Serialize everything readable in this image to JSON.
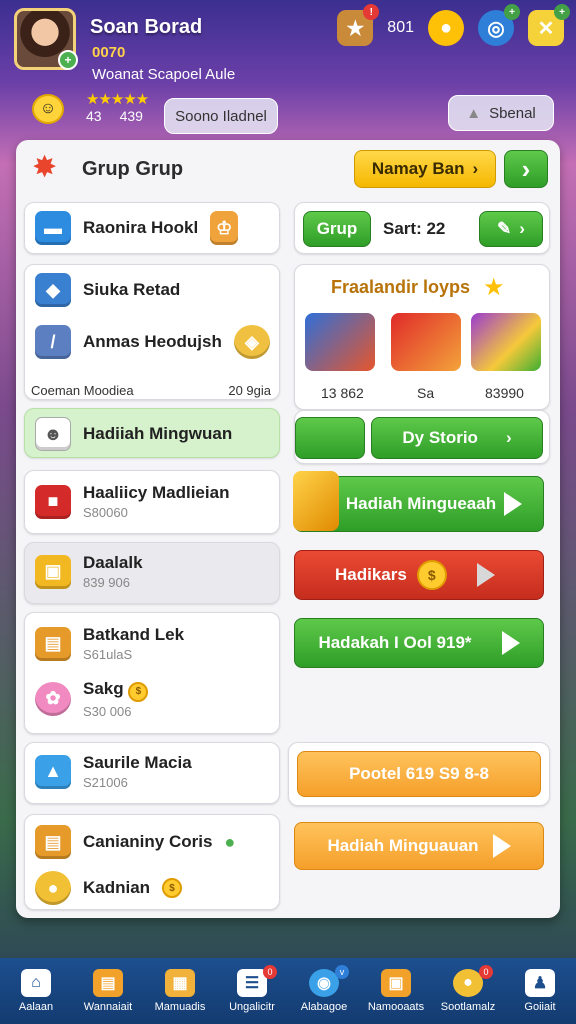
{
  "header": {
    "player_name": "Soan Borad",
    "player_sub": "0070",
    "player_desc": "Woanat Scapoel Aule",
    "coin_count": "801",
    "stat_left": "43",
    "stat_right": "439",
    "center_button": "Soono Iladnel",
    "right_button": "Sbenal"
  },
  "panel": {
    "title": "Grup Grup",
    "top_button": "Namay Ban",
    "left": {
      "card1": {
        "title": "Raonira Hookl"
      },
      "card2": {
        "item1": "Siuka Retad",
        "item2": "Anmas Heodujsh",
        "footer_left": "Coeman Moodiea",
        "footer_right": "20 9gia"
      },
      "card3": {
        "title": "Hadiiah Mingwuan"
      },
      "card4": {
        "title": "Haaliicy Madlieian",
        "sub": "S80060"
      },
      "card5": {
        "title": "Daalalk",
        "sub": "839 906"
      },
      "card6": {
        "item1": "Batkand Lek",
        "sub1": "S61ulaS",
        "item2": "Sakg",
        "sub2": "S30 006"
      },
      "card7": {
        "title": "Saurile Macia",
        "sub": "S21006"
      },
      "card8": {
        "item1": "Canianiny Coris",
        "item2": "Kadnian"
      }
    },
    "right": {
      "group_button": "Grup",
      "group_label": "Sart: 22",
      "rewards_title": "Fraalandir loyps",
      "reward_values": [
        "13 862",
        "Sa",
        "83990"
      ],
      "story_button": "Dy Storio",
      "btn1": "Hadiah Mingueaah",
      "btn2": "Hadikars",
      "btn3": "Hadakah I Ool 919*",
      "btn4": "Pootel 619 S9 8-8",
      "btn5": "Hadiah Minguauan"
    }
  },
  "nav": [
    {
      "label": "Aalaan",
      "icon": "home-icon"
    },
    {
      "label": "Wannaiait",
      "icon": "chest-icon"
    },
    {
      "label": "Mamuadis",
      "icon": "calendar-icon"
    },
    {
      "label": "Ungalicitr",
      "icon": "list-icon",
      "badge": "0"
    },
    {
      "label": "Alabagoe",
      "icon": "globe-icon",
      "badge": "v"
    },
    {
      "label": "Namooaats",
      "icon": "treasure-icon"
    },
    {
      "label": "Sootlamalz",
      "icon": "coins-icon",
      "badge": "0"
    },
    {
      "label": "Goiiait",
      "icon": "friends-icon"
    }
  ],
  "colors": {
    "green": "#3cae33",
    "red": "#d83a28",
    "yellow": "#f5c518",
    "orange": "#f7a83a",
    "nav_bg": "#1a4a8a"
  }
}
